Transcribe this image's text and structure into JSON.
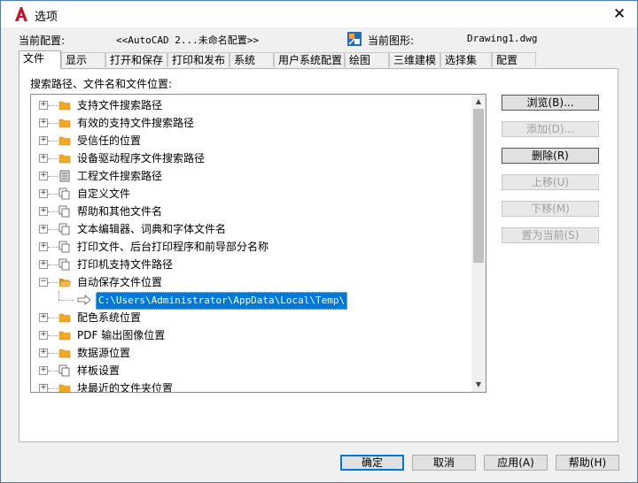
{
  "window": {
    "title": "选项",
    "close": "✕"
  },
  "profile": {
    "label": "当前配置:",
    "value": "<<AutoCAD 2...未命名配置>>"
  },
  "drawing": {
    "label": "当前图形:",
    "value": "Drawing1.dwg"
  },
  "tabs": [
    "文件",
    "显示",
    "打开和保存",
    "打印和发布",
    "系统",
    "用户系统配置",
    "绘图",
    "三维建模",
    "选择集",
    "配置"
  ],
  "active_tab": "文件",
  "section_label": "搜索路径、文件名和文件位置:",
  "tree": {
    "items": [
      {
        "label": "支持文件搜索路径",
        "icon": "folder-icon",
        "expander": "+"
      },
      {
        "label": "有效的支持文件搜索路径",
        "icon": "folder-icon",
        "expander": "+"
      },
      {
        "label": "受信任的位置",
        "icon": "folder-icon",
        "expander": "+"
      },
      {
        "label": "设备驱动程序文件搜索路径",
        "icon": "folder-icon",
        "expander": "+"
      },
      {
        "label": "工程文件搜索路径",
        "icon": "cabinet-icon",
        "expander": "+"
      },
      {
        "label": "自定义文件",
        "icon": "documents-icon",
        "expander": "+"
      },
      {
        "label": "帮助和其他文件名",
        "icon": "documents-icon",
        "expander": "+"
      },
      {
        "label": "文本编辑器、词典和字体文件名",
        "icon": "documents-icon",
        "expander": "+"
      },
      {
        "label": "打印文件、后台打印程序和前导部分名称",
        "icon": "documents-icon",
        "expander": "+"
      },
      {
        "label": "打印机支持文件路径",
        "icon": "documents-icon",
        "expander": "+"
      },
      {
        "label": "自动保存文件位置",
        "icon": "open-folder-icon",
        "expander": "−"
      },
      {
        "label": "配色系统位置",
        "icon": "folder-icon",
        "expander": "+"
      },
      {
        "label": "PDF 输出图像位置",
        "icon": "folder-icon",
        "expander": "+"
      },
      {
        "label": "数据源位置",
        "icon": "folder-icon",
        "expander": "+"
      },
      {
        "label": "样板设置",
        "icon": "documents-icon",
        "expander": "+"
      },
      {
        "label": "块最近的文件夹位置",
        "icon": "folder-icon",
        "expander": "+"
      }
    ],
    "selected_path": "C:\\Users\\Administrator\\AppData\\Local\\Temp\\"
  },
  "side_buttons": [
    {
      "label": "浏览(B)...",
      "enabled": true
    },
    {
      "label": "添加(D)...",
      "enabled": false
    },
    {
      "label": "删除(R)",
      "enabled": true
    },
    {
      "label": "上移(U)",
      "enabled": false
    },
    {
      "label": "下移(M)",
      "enabled": false
    },
    {
      "label": "置为当前(S)",
      "enabled": false
    }
  ],
  "footer_buttons": {
    "ok": "确定",
    "cancel": "取消",
    "apply": "应用(A)",
    "help": "帮助(H)"
  },
  "colors": {
    "accent": "#0078d7",
    "autocad_red": "#c8102e",
    "folder": "#f5a623"
  }
}
